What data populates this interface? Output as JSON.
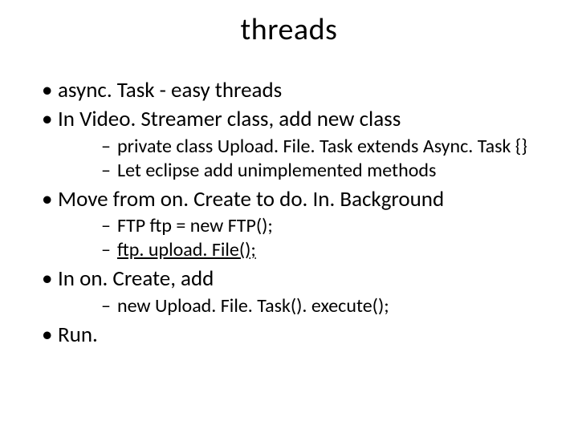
{
  "title": "threads",
  "bullets": {
    "b1": "async. Task - easy threads",
    "b2": "In Video. Streamer class, add new class",
    "b2_sub": {
      "s1": "private class Upload. File. Task extends Async. Task {}",
      "s2": "Let eclipse add unimplemented methods"
    },
    "b3": "Move from on. Create to do. In. Background",
    "b3_sub": {
      "s1": "FTP ftp = new FTP();",
      "s2": "ftp. upload. File();"
    },
    "b4": "In on. Create, add",
    "b4_sub": {
      "s1": "new Upload. File. Task(). execute();"
    },
    "b5": "Run."
  }
}
